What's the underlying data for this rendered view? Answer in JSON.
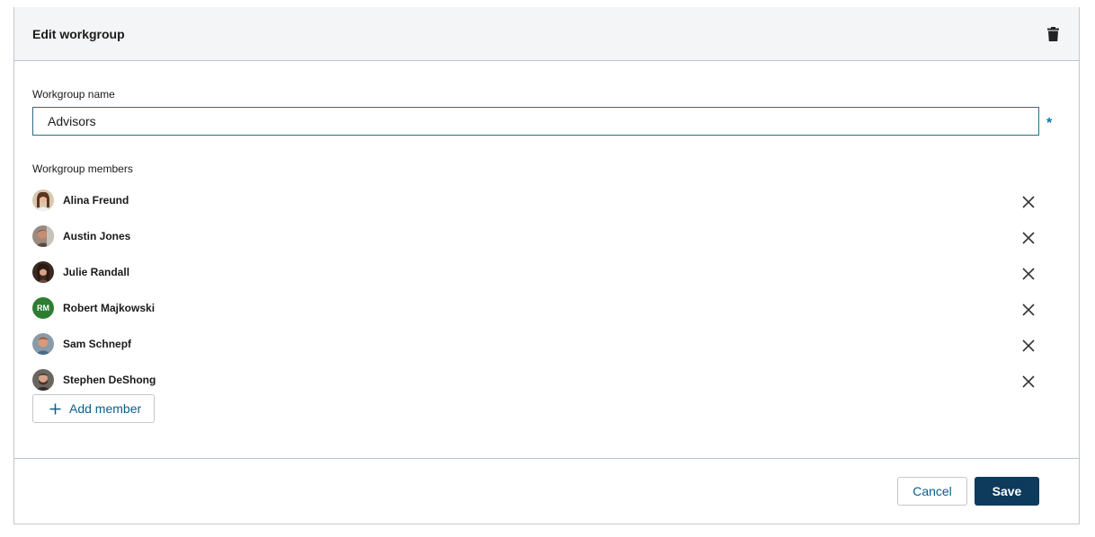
{
  "header": {
    "title": "Edit workgroup",
    "delete_icon": "trash-icon"
  },
  "form": {
    "name_label": "Workgroup name",
    "name_value": "Advisors",
    "required_mark": "*",
    "members_label": "Workgroup members"
  },
  "members": [
    {
      "name": "Alina Freund",
      "avatar": "photo"
    },
    {
      "name": "Austin Jones",
      "avatar": "photo"
    },
    {
      "name": "Julie Randall",
      "avatar": "photo"
    },
    {
      "name": "Robert Majkowski",
      "avatar": "initials",
      "initials": "RM"
    },
    {
      "name": "Sam Schnepf",
      "avatar": "photo"
    },
    {
      "name": "Stephen DeShong",
      "avatar": "photo"
    }
  ],
  "add_member_label": "Add member",
  "footer": {
    "cancel_label": "Cancel",
    "save_label": "Save"
  },
  "colors": {
    "primary": "#0e3a5c",
    "link": "#0a5e8c",
    "required": "#0a74b5",
    "initials_avatar": "#2e7d32"
  }
}
